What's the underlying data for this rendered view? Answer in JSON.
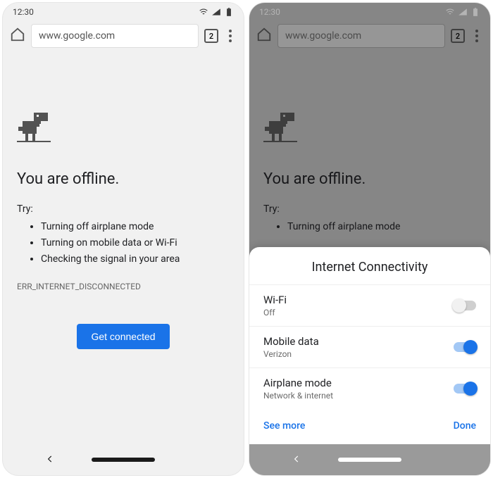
{
  "status": {
    "time": "12:30"
  },
  "toolbar": {
    "url": "www.google.com",
    "tab_count": "2"
  },
  "offline": {
    "heading": "You are offline.",
    "try_label": "Try:",
    "tips": [
      "Turning off airplane mode",
      "Turning on mobile data or Wi-Fi",
      "Checking the signal in your area"
    ],
    "error_code": "ERR_INTERNET_DISCONNECTED",
    "cta": "Get connected"
  },
  "sheet": {
    "title": "Internet Connectivity",
    "rows": [
      {
        "primary": "Wi-Fi",
        "secondary": "Off",
        "on": false
      },
      {
        "primary": "Mobile data",
        "secondary": "Verizon",
        "on": true
      },
      {
        "primary": "Airplane mode",
        "secondary": "Network & internet",
        "on": true
      }
    ],
    "see_more": "See more",
    "done": "Done"
  }
}
